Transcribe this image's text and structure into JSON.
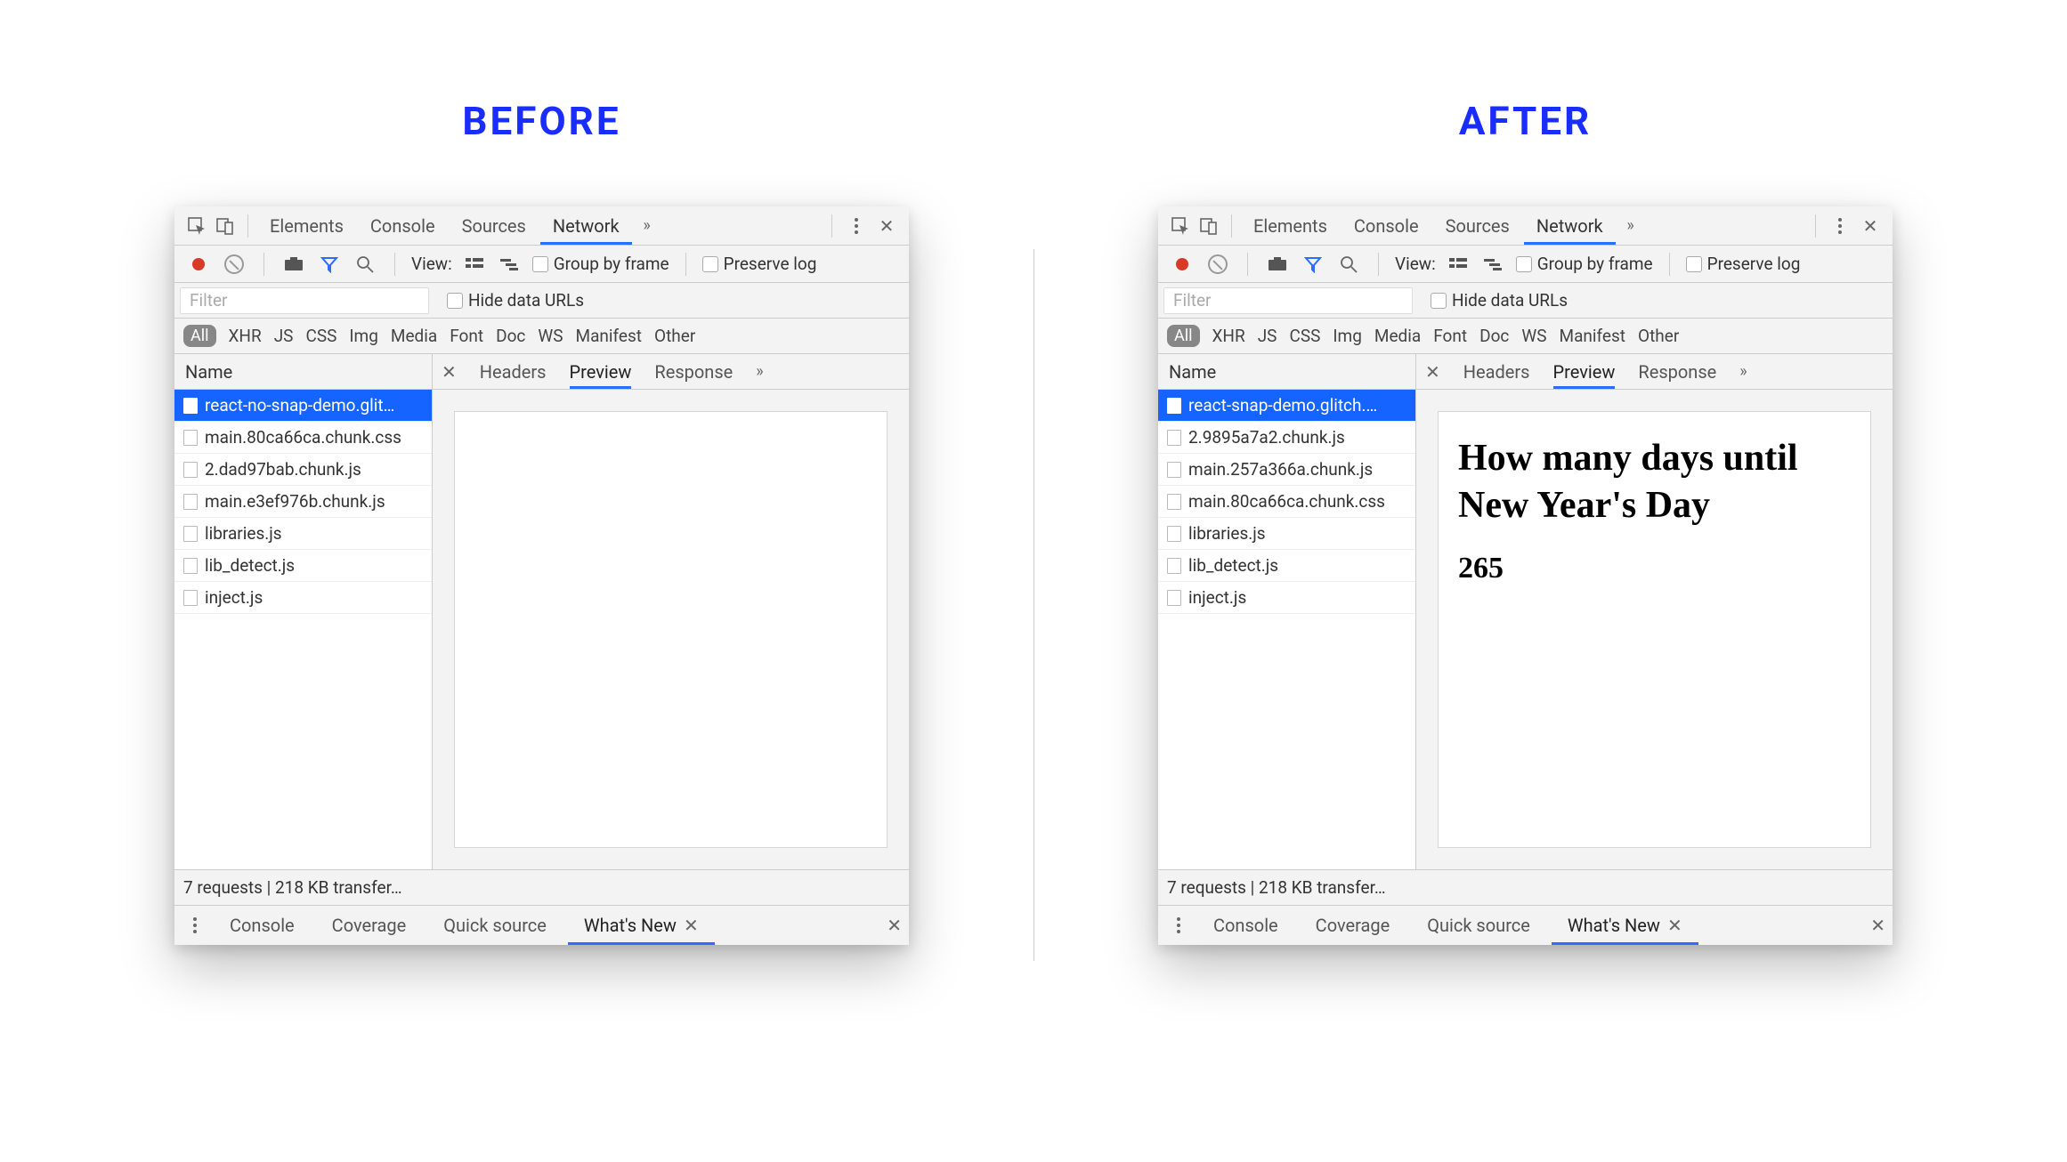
{
  "headings": {
    "before": "BEFORE",
    "after": "AFTER"
  },
  "top_tabs": {
    "elements": "Elements",
    "console": "Console",
    "sources": "Sources",
    "network": "Network"
  },
  "toolbar": {
    "view": "View:",
    "group_by_frame": "Group by frame",
    "preserve_log": "Preserve log"
  },
  "filter": {
    "placeholder": "Filter",
    "hide_data_urls": "Hide data URLs"
  },
  "chips": {
    "all": "All",
    "xhr": "XHR",
    "js": "JS",
    "css": "CSS",
    "img": "Img",
    "media": "Media",
    "font": "Font",
    "doc": "Doc",
    "ws": "WS",
    "manifest": "Manifest",
    "other": "Other"
  },
  "req_head": "Name",
  "detail_tabs": {
    "headers": "Headers",
    "preview": "Preview",
    "response": "Response"
  },
  "status": "7 requests | 218 KB transfer…",
  "drawer": {
    "console": "Console",
    "coverage": "Coverage",
    "quick_source": "Quick source",
    "whats_new": "What's New"
  },
  "before": {
    "requests": [
      {
        "name": "react-no-snap-demo.glit…",
        "selected": true
      },
      {
        "name": "main.80ca66ca.chunk.css"
      },
      {
        "name": "2.dad97bab.chunk.js"
      },
      {
        "name": "main.e3ef976b.chunk.js"
      },
      {
        "name": "libraries.js"
      },
      {
        "name": "lib_detect.js"
      },
      {
        "name": "inject.js"
      }
    ],
    "preview": {
      "title": "",
      "value": ""
    }
  },
  "after": {
    "requests": [
      {
        "name": "react-snap-demo.glitch.…",
        "selected": true
      },
      {
        "name": "2.9895a7a2.chunk.js"
      },
      {
        "name": "main.257a366a.chunk.js"
      },
      {
        "name": "main.80ca66ca.chunk.css"
      },
      {
        "name": "libraries.js"
      },
      {
        "name": "lib_detect.js"
      },
      {
        "name": "inject.js"
      }
    ],
    "preview": {
      "title": "How many days until New Year's Day",
      "value": "265"
    }
  }
}
